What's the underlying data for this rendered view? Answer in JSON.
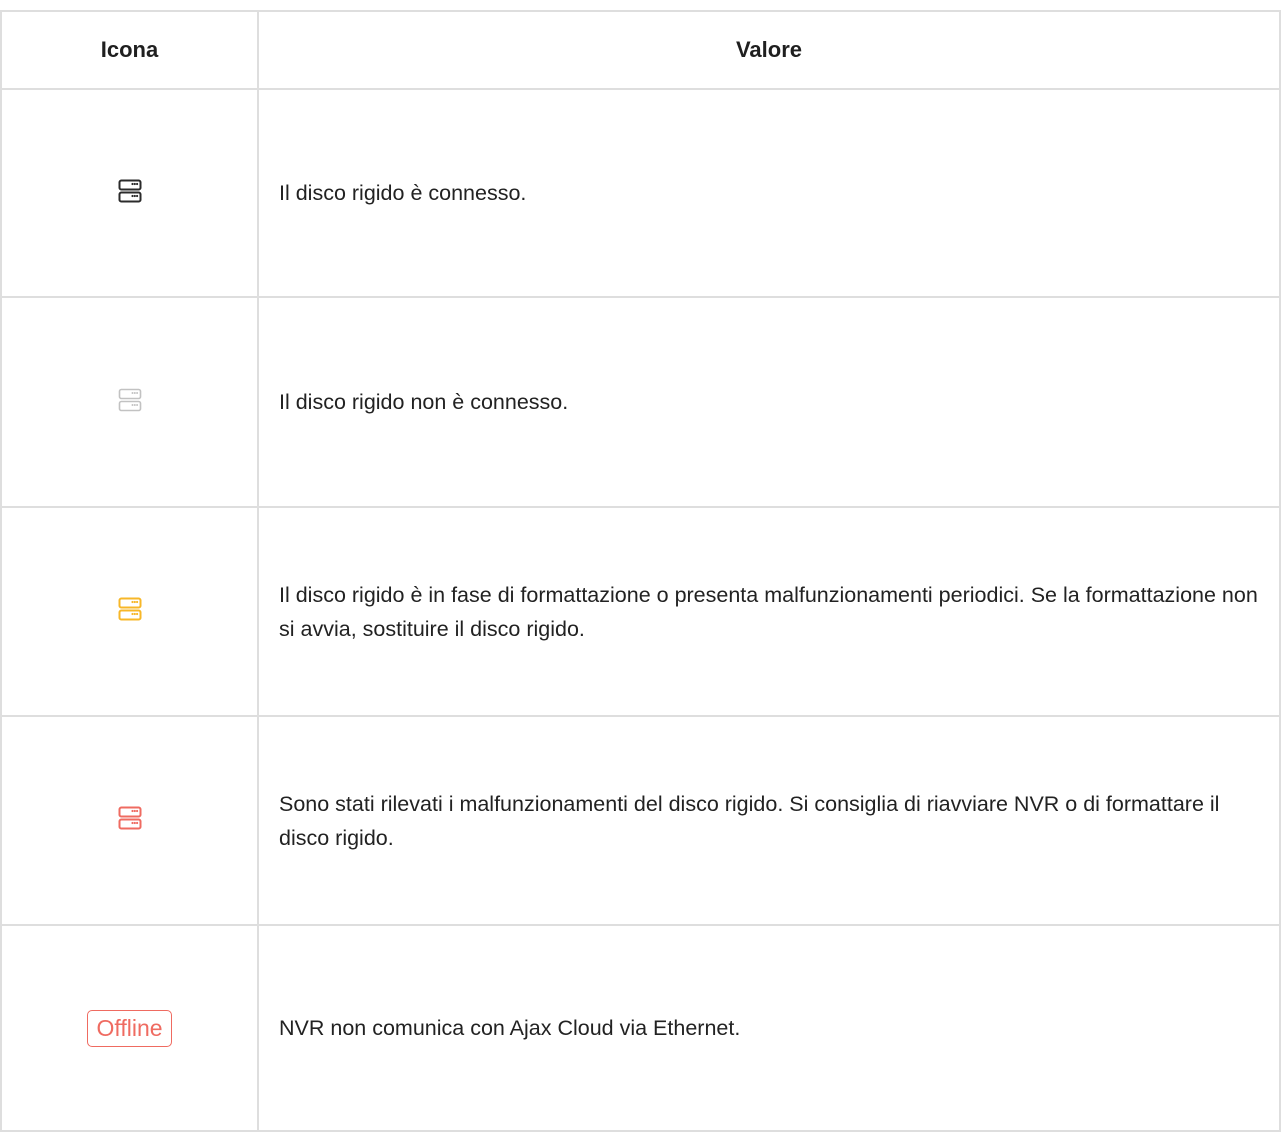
{
  "table": {
    "headers": {
      "icon": "Icona",
      "value": "Valore"
    },
    "rows": [
      {
        "icon": "hdd-connected-icon",
        "icon_color": "#2b2b2b",
        "value": "Il disco rigido è connesso."
      },
      {
        "icon": "hdd-disconnected-icon",
        "icon_color": "#c2c2c2",
        "value": "Il disco rigido non è connesso."
      },
      {
        "icon": "hdd-formatting-icon",
        "icon_color": "#f7b728",
        "value": "Il disco rigido è in fase di formattazione o presenta malfunzionamenti periodici. Se la formattazione non si avvia, sostituire il disco rigido."
      },
      {
        "icon": "hdd-malfunction-icon",
        "icon_color": "#ef6b61",
        "value": "Sono stati rilevati i malfunzionamenti del disco rigido. Si consiglia di riavviare NVR o di formattare il disco rigido."
      },
      {
        "icon": "offline-badge",
        "icon_color": "#ef6b61",
        "badge_text": "Offline",
        "value": "NVR non comunica con Ajax Cloud via Ethernet."
      }
    ]
  }
}
